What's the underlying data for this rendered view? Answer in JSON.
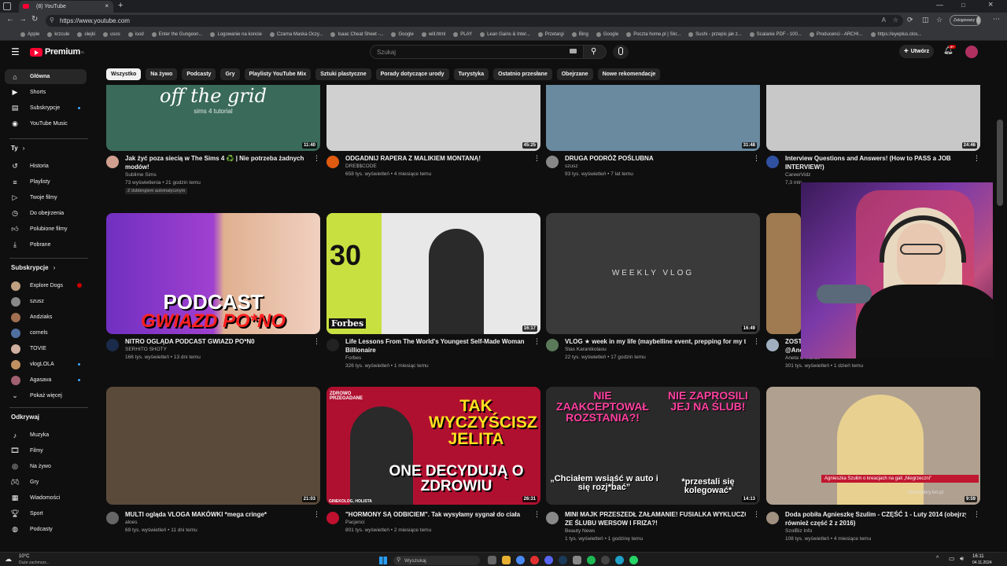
{
  "browser": {
    "tab_title": "(8) YouTube",
    "url": "https://www.youtube.com",
    "profile_label": "Zalogowany",
    "bookmarks": [
      "Apple",
      "krzcule",
      "olejki",
      "usos",
      "isod",
      "Enter the Gungeon...",
      "Logowanie na koncie",
      "Czarna Maska Oczy...",
      "Isaac Cheat Sheet -...",
      "Google",
      "will.html",
      "PLAY",
      "Lean Gains & Inter...",
      "Przetargi",
      "Bing",
      "Google",
      "Poczta home.pl | Skr...",
      "Sushi - przepis jak z...",
      "Scalanie PDF - 100...",
      "Producenci - ARCHI...",
      "https://eyeplus.clos..."
    ]
  },
  "header": {
    "logo_text": "Premium",
    "logo_region": "PL",
    "search_placeholder": "Szukaj",
    "create_label": "Utwórz",
    "notification_count": "9+"
  },
  "chips": [
    "Wszystko",
    "Na żywo",
    "Podcasty",
    "Gry",
    "Playlisty YouTube Mix",
    "Sztuki plastyczne",
    "Porady dotyczące urody",
    "Turystyka",
    "Ostatnio przesłane",
    "Obejrzane",
    "Nowe rekomendacje"
  ],
  "sidebar": {
    "main": [
      {
        "label": "Główna",
        "icon": "home-icon"
      },
      {
        "label": "Shorts",
        "icon": "shorts-icon"
      },
      {
        "label": "Subskrypcje",
        "icon": "subscriptions-icon"
      },
      {
        "label": "YouTube Music",
        "icon": "music-icon"
      }
    ],
    "you_heading": "Ty",
    "you": [
      {
        "label": "Historia",
        "icon": "history-icon"
      },
      {
        "label": "Playlisty",
        "icon": "playlist-icon"
      },
      {
        "label": "Twoje filmy",
        "icon": "video-icon"
      },
      {
        "label": "Do obejrzenia",
        "icon": "clock-icon"
      },
      {
        "label": "Polubione filmy",
        "icon": "like-icon"
      },
      {
        "label": "Pobrane",
        "icon": "download-icon"
      }
    ],
    "subs_heading": "Subskrypcje",
    "subs": [
      {
        "label": "Explore Dogs",
        "badge": "live",
        "color": "#c0a080"
      },
      {
        "label": "szusz",
        "color": "#888"
      },
      {
        "label": "Andziaks",
        "color": "#a07050"
      },
      {
        "label": "cornels",
        "color": "#5070a0"
      },
      {
        "label": "TOVIE",
        "color": "#d0b0a0"
      },
      {
        "label": "vlogLOLA",
        "color": "#c09060"
      },
      {
        "label": "Agasava",
        "color": "#a06070"
      }
    ],
    "show_more": "Pokaż więcej",
    "explore_heading": "Odkrywaj",
    "explore": [
      {
        "label": "Muzyka",
        "icon": "music-note-icon"
      },
      {
        "label": "Filmy",
        "icon": "film-icon"
      },
      {
        "label": "Na żywo",
        "icon": "live-icon"
      },
      {
        "label": "Gry",
        "icon": "gamepad-icon"
      },
      {
        "label": "Wiadomości",
        "icon": "news-icon"
      },
      {
        "label": "Sport",
        "icon": "trophy-icon"
      },
      {
        "label": "Podcasty",
        "icon": "podcast-icon"
      }
    ]
  },
  "videos": [
    {
      "title1": "Jak żyć poza siecią w The Sims 4 ♻️ | Nie potrzeba żadnych",
      "title2": "modów!",
      "channel": "Sublime Sims",
      "meta": "73 wyświetlenia • 21 godzin temu",
      "extra": "Z dubbingiem automatycznym",
      "duration": "11:40",
      "overlay": "off the grid",
      "overlay2": "sims 4 tutorial",
      "bg": "#3a6a5a"
    },
    {
      "title1": "ODGADNIJ RAPERA Z MALIKIEM MONTANĄ!",
      "title2": "",
      "channel": "DRE$$CODE",
      "meta": "658 tys. wyświetleń • 4 miesiące temu",
      "duration": "45:25",
      "bg": "#d0d0d0"
    },
    {
      "title1": "DRUGA PODRÓŻ POŚLUBNA",
      "title2": "",
      "channel": "szusz",
      "meta": "93 tys. wyświetleń • 7 lat temu",
      "duration": "31:48",
      "bg": "#6a8aa0"
    },
    {
      "title1": "Interview Questions and Answers! (How to PASS a JOB",
      "title2": "INTERVIEW!)",
      "channel": "CareerVidz",
      "meta": "7,3 mln",
      "duration": "24:46",
      "bg": "#c8c8c8"
    },
    {
      "title1": "NITRO OGLĄDA PODCAST GWIAZD PO*N0",
      "title2": "",
      "channel": "SERHITO SHOTY",
      "meta": "166 tys. wyświetleń • 13 dni temu",
      "duration": "",
      "overlay": "PODCAST",
      "overlay2": "GWIAZD PO*NO",
      "bg": "#6a2aa0"
    },
    {
      "title1": "Life Lessons From The World's Youngest Self-Made Woman",
      "title2": "Billionaire",
      "channel": "Forbes",
      "meta": "326 tys. wyświetleń • 1 miesiąc temu",
      "duration": "16:17",
      "overlay": "30",
      "overlay2": "Forbes",
      "bg": "#e8e8e8"
    },
    {
      "title1": "VLOG ★ week in my life (maybelline event, prepping for my trip)",
      "title2": "",
      "channel": "Stas Karanikolaou",
      "meta": "22 tys. wyświetleń • 17 godzin temu",
      "duration": "16:49",
      "overlay": "WEEKLY VLOG",
      "bg": "#3a3a3a"
    },
    {
      "title1": "ZOSTA",
      "title2": "@Ane",
      "channel": "Aneta w Irlandii",
      "meta": "301 tys. wyświetleń • 1 dzień temu",
      "duration": "",
      "bg": "#a07a50"
    },
    {
      "title1": "MULTI ogląda VLOGA MAKÓWKI *mega cringe*",
      "title2": "",
      "channel": "aloes",
      "meta": "69 tys. wyświetleń • 11 dni temu",
      "duration": "21:03",
      "bg": "#5a4a3a"
    },
    {
      "title1": "\"HORMONY SĄ ODBICIEM\". Tak wysyłamy sygnał do ciała",
      "title2": "",
      "channel": "Pacjenci",
      "meta": "801 tys. wyświetleń • 2 miesiące temu",
      "duration": "26:31",
      "overlay": "TAK WYCZYŚCISZ JELITA",
      "overlay2": "ONE DECYDUJĄ O ZDROWIU",
      "overlay3": "GINEKOLOG, HOLISTA",
      "overlay4": "ZDROWO PRZEGADANE",
      "bg": "#b01030"
    },
    {
      "title1": "MINI MAJK PRZESZEDŁ ZAŁAMANIE! FUSIALKA WYKLUCZONA",
      "title2": "ZE ŚLUBU WERSOW I FRIZA?!",
      "channel": "Beauty News",
      "meta": "1 tys. wyświetleń • 1 godzinę temu",
      "duration": "14:13",
      "overlay": "NIE ZAAKCEPTOWAŁ ROZSTANIA?!",
      "overlay2": "NIE ZAPROSILI JEJ NA ŚLUB!",
      "overlay3": "„Chciałem wsiąść w auto i się rozj*bać”",
      "overlay4": "*przestali się kolegować*",
      "bg": "#2a2a2a"
    },
    {
      "title1": "Doda pobiła Agnieszkę Szulim - CZĘŚĆ 1 - Luty 2014 (obejrzyj",
      "title2": "również część 2 z 2016)",
      "channel": "SzolBiz Info",
      "meta": "108 tys. wyświetleń • 4 miesiące temu",
      "duration": "9:59",
      "overlay": "Agnieszka Szulim o kreacjach na gali „Niegrzeczni”",
      "overlay2": "dziendobry.tvn.pl",
      "bg": "#b0a090"
    }
  ],
  "taskbar": {
    "weather_temp": "10°C",
    "weather_desc": "Duże zachmurz...",
    "search_label": "Wyszukaj",
    "time": "16:11",
    "date": "04.11.2024"
  }
}
